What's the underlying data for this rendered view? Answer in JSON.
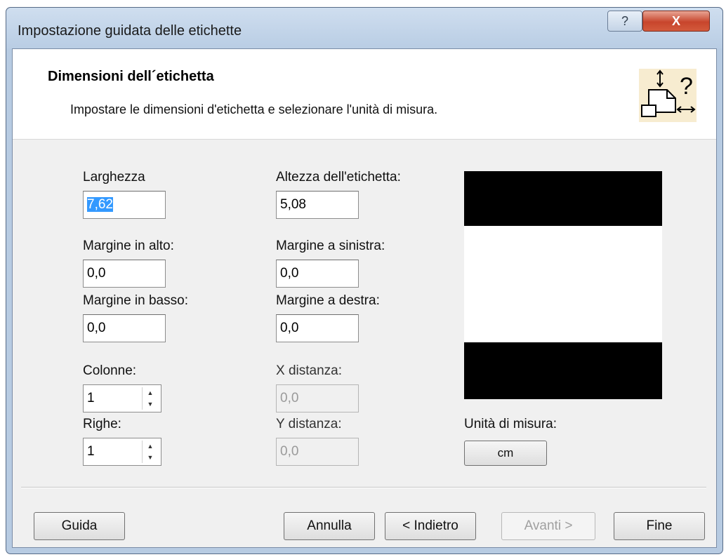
{
  "window": {
    "title": "Impostazione guidata delle etichette",
    "help_glyph": "?",
    "close_glyph": "X"
  },
  "header": {
    "title": "Dimensioni dell´etichetta",
    "subtitle": "Impostare le dimensioni d'etichetta e selezionare l'unità di misura.",
    "icon": "label-size-help-icon"
  },
  "form": {
    "width": {
      "label": "Larghezza",
      "value": "7,62"
    },
    "height": {
      "label": "Altezza dell'etichetta:",
      "value": "5,08"
    },
    "top_margin": {
      "label": "Margine in alto:",
      "value": "0,0"
    },
    "left_margin": {
      "label": "Margine a sinistra:",
      "value": "0,0"
    },
    "bottom_margin": {
      "label": "Margine in basso:",
      "value": "0,0"
    },
    "right_margin": {
      "label": "Margine a destra:",
      "value": "0,0"
    },
    "columns": {
      "label": "Colonne:",
      "value": "1"
    },
    "rows": {
      "label": "Righe:",
      "value": "1"
    },
    "x_distance": {
      "label": "X distanza:",
      "value": "0,0"
    },
    "y_distance": {
      "label": "Y distanza:",
      "value": "0,0"
    },
    "units": {
      "label": "Unità di misura:",
      "value": "cm"
    }
  },
  "buttons": {
    "help": "Guida",
    "cancel": "Annulla",
    "back": "< Indietro",
    "next": "Avanti >",
    "finish": "Fine"
  },
  "colors": {
    "selection": "#3399ff",
    "close_button": "#c8452c",
    "titlebar": "#b9cde4"
  }
}
